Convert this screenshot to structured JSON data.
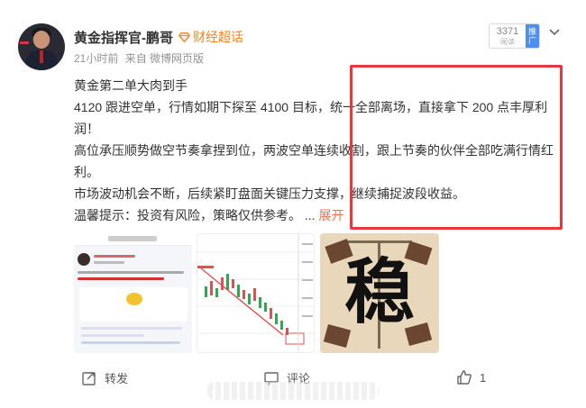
{
  "post": {
    "author": "黄金指挥官-鹏哥",
    "badge": "财经超话",
    "time": "21小时前",
    "source": "来自 微博网页版",
    "views": {
      "count": "3371",
      "label": "阅读",
      "push_label": "推广"
    },
    "content": {
      "line1": "黄金第二单大肉到手",
      "line2": "4120 跟进空单，行情如期下探至 4100 目标，统一全部离场，直接拿下 200 点丰厚利润！",
      "line3": "高位承压顺势做空节奏拿捏到位，两波空单连续收割，跟上节奏的伙伴全部吃满行情红利。",
      "line4": "市场波动机会不断，后续紧盯盘面关键压力支撑，继续捕捉波段收益。",
      "line5": "温馨提示：投资有风险，策略仅供参考。",
      "ellipsis": "...",
      "expand": "展开"
    },
    "images": {
      "img3_char": "稳"
    }
  },
  "actions": {
    "repost": "转发",
    "comment": "评论",
    "like_count": "1"
  },
  "colors": {
    "accent": "#eb7350",
    "badge": "#f5821f",
    "highlight_box": "#e8383d",
    "push_blue": "#4d8ff0"
  },
  "icons": [
    "diamond-icon",
    "chevron-down-icon",
    "repost-icon",
    "comment-icon",
    "like-icon"
  ]
}
